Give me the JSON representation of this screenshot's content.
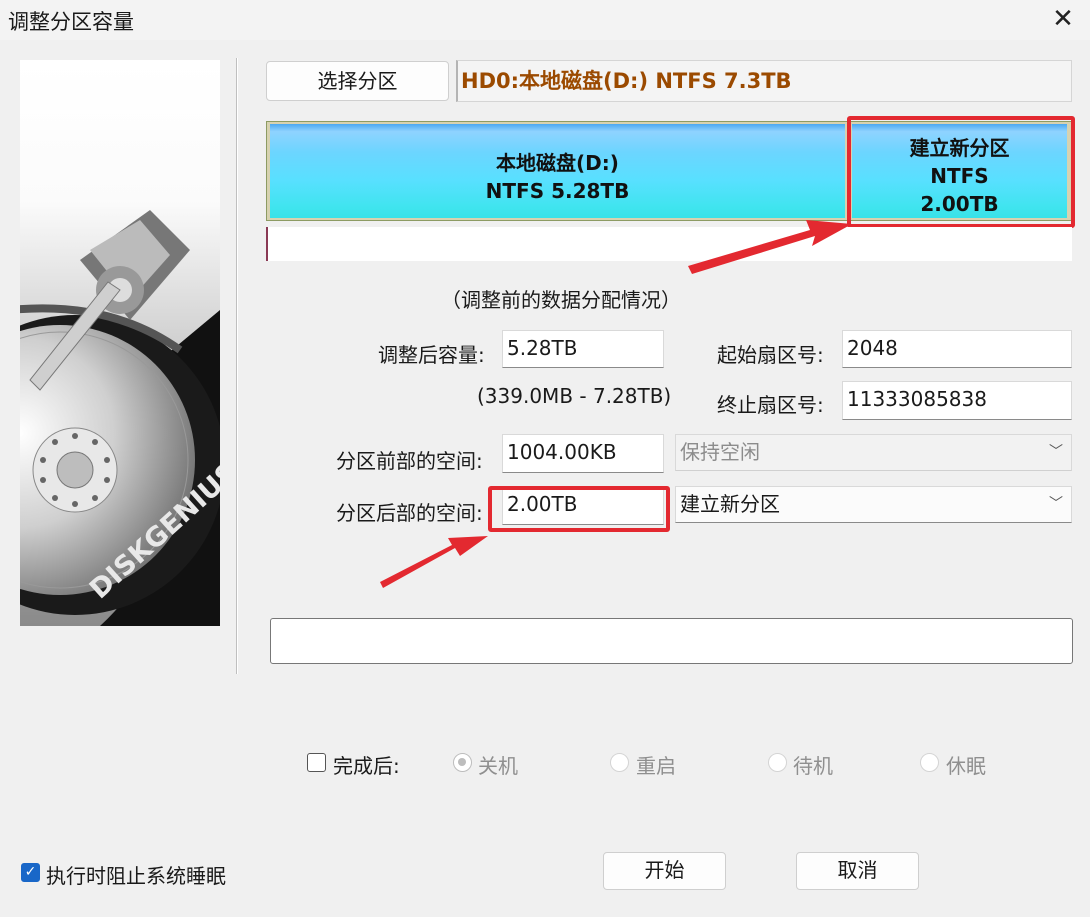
{
  "window": {
    "title": "调整分区容量",
    "close_icon": "close-icon"
  },
  "toolbar": {
    "select_partition_label": "选择分区",
    "disk_info": "HD0:本地磁盘(D:) NTFS 7.3TB",
    "disk_info_color": "#9b4a00"
  },
  "partition_map": {
    "segments": [
      {
        "name": "本地磁盘(D:)",
        "fs": "NTFS 5.28TB"
      },
      {
        "name": "建立新分区",
        "fs": "NTFS",
        "size": "2.00TB"
      }
    ],
    "caption": "（调整前的数据分配情况）"
  },
  "form": {
    "adjusted_size_label": "调整后容量:",
    "adjusted_size_value": "5.28TB",
    "size_range": "(339.0MB - 7.28TB)",
    "start_sector_label": "起始扇区号:",
    "start_sector_value": "2048",
    "end_sector_label": "终止扇区号:",
    "end_sector_value": "11333085838",
    "space_before_label": "分区前部的空间:",
    "space_before_value": "1004.00KB",
    "space_before_action": "保持空闲",
    "space_after_label": "分区后部的空间:",
    "space_after_value": "2.00TB",
    "space_after_action": "建立新分区"
  },
  "after_completion": {
    "label": "完成后:",
    "checked": false,
    "options": [
      {
        "label": "关机",
        "selected": true
      },
      {
        "label": "重启",
        "selected": false
      },
      {
        "label": "待机",
        "selected": false
      },
      {
        "label": "休眠",
        "selected": false
      }
    ]
  },
  "prevent_sleep": {
    "label": "执行时阻止系统睡眠",
    "checked": true
  },
  "buttons": {
    "start": "开始",
    "cancel": "取消"
  },
  "colors": {
    "highlight_red": "#e32930",
    "partition_blue": "#58e0ff",
    "check_blue": "#1967c8"
  },
  "image": {
    "brand_text": "DISKGENIUS"
  }
}
